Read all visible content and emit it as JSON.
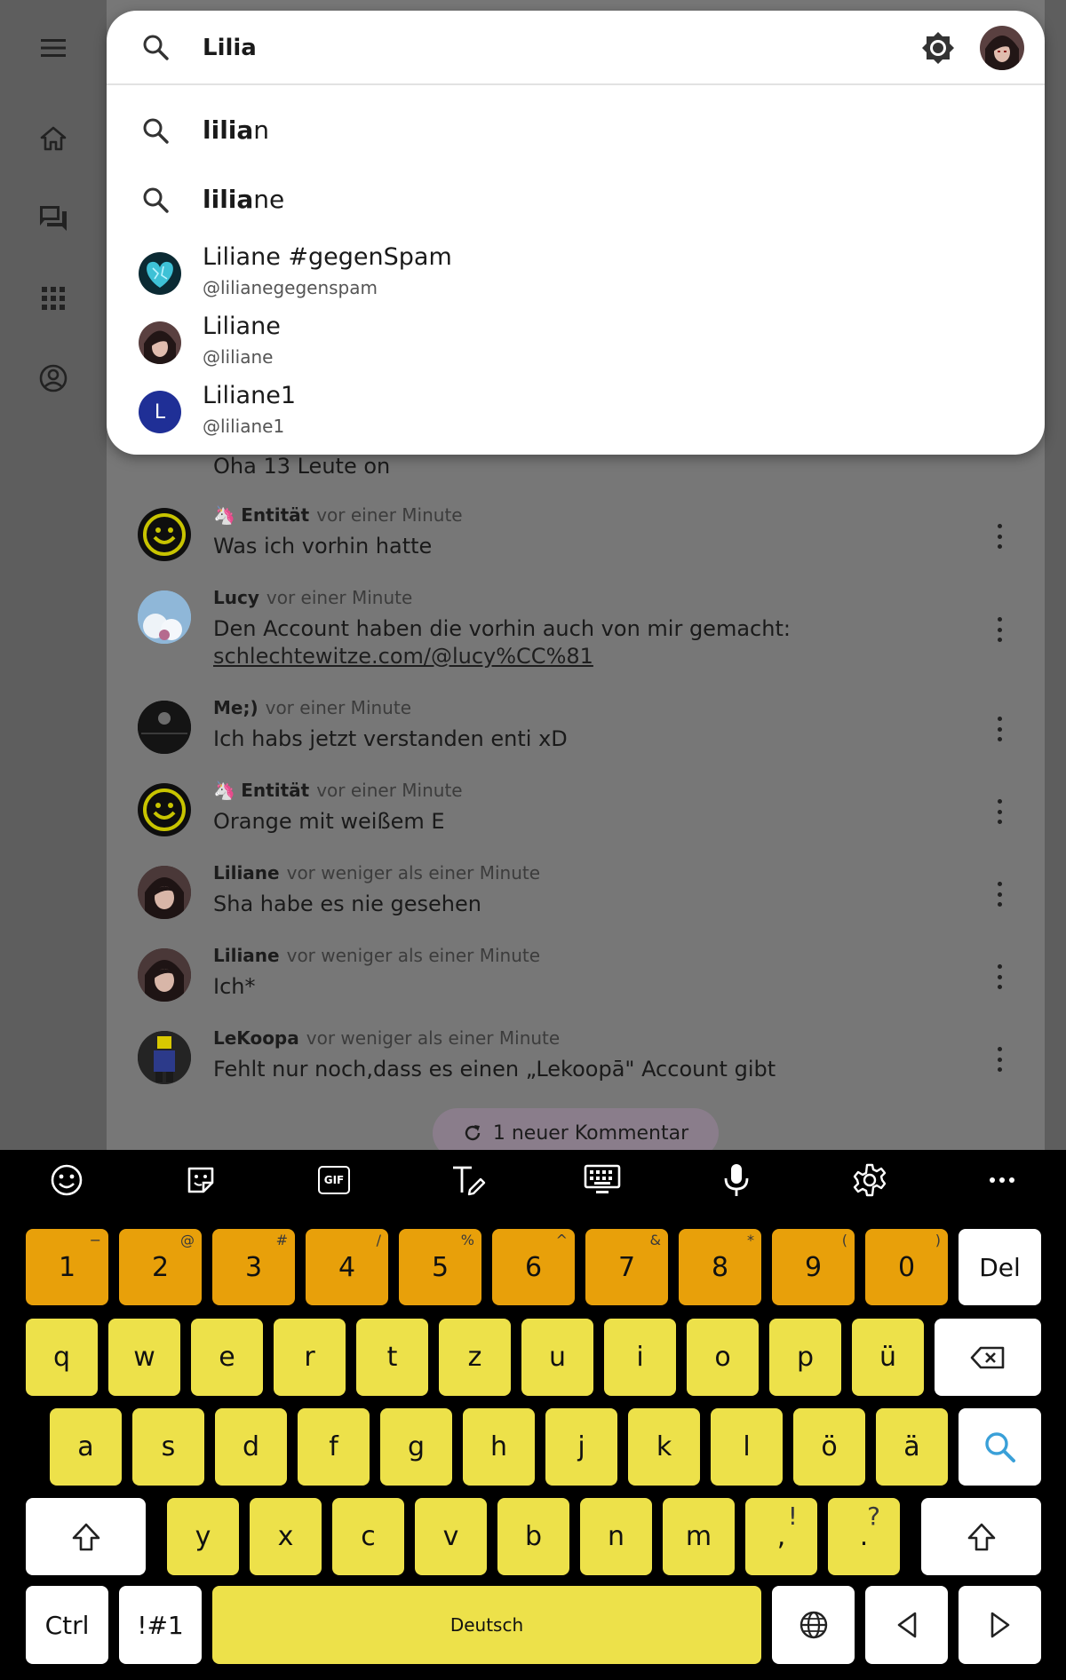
{
  "rail": {
    "items": [
      "menu-icon",
      "home-icon",
      "forum-icon",
      "apps-icon",
      "account-icon"
    ]
  },
  "search": {
    "value": "Lilia",
    "suggestions": [
      {
        "match": "lilia",
        "rest": "n"
      },
      {
        "match": "lilia",
        "rest": "ne"
      }
    ],
    "users": [
      {
        "name": "Liliane #gegenSpam",
        "handle": "@lilianegegenspam"
      },
      {
        "name": "Liliane",
        "handle": "@liliane"
      },
      {
        "name": "Liliane1",
        "handle": "@liliane1",
        "initial": "L"
      }
    ]
  },
  "comments": [
    {
      "author": "",
      "time": "",
      "text": "Oha 13 Leute on"
    },
    {
      "author": "Entität",
      "time": "vor einer Minute",
      "text": "Was ich vorhin hatte"
    },
    {
      "author": "Lucy",
      "time": "vor einer Minute",
      "text": "Den Account haben die vorhin auch von mir gemacht:",
      "link": "schlechtewitze.com/@lucy%CC%81"
    },
    {
      "author": "Me;)",
      "time": "vor einer Minute",
      "text": "Ich habs jetzt verstanden enti xD"
    },
    {
      "author": "Entität",
      "time": "vor einer Minute",
      "text": "Orange mit weißem E"
    },
    {
      "author": "Liliane",
      "time": "vor weniger als einer Minute",
      "text": "Sha habe es nie gesehen"
    },
    {
      "author": "Liliane",
      "time": "vor weniger als einer Minute",
      "text": "Ich*"
    },
    {
      "author": "LeKoopa",
      "time": "vor weniger als einer Minute",
      "text": "Fehlt nur noch,dass es einen „Lekoopā\" Account gibt"
    }
  ],
  "new_comment_label": "1 neuer Kommentar",
  "keyboard": {
    "toolbar": [
      "emoji-icon",
      "sticker-icon",
      "gif-icon",
      "handwriting-icon",
      "keyboard-icon",
      "mic-icon",
      "settings-icon",
      "more-icon"
    ],
    "gif_label": "GIF",
    "numbers": [
      {
        "main": "1",
        "sub": "−"
      },
      {
        "main": "2",
        "sub": "@"
      },
      {
        "main": "3",
        "sub": "#"
      },
      {
        "main": "4",
        "sub": "/"
      },
      {
        "main": "5",
        "sub": "%"
      },
      {
        "main": "6",
        "sub": "^"
      },
      {
        "main": "7",
        "sub": "&"
      },
      {
        "main": "8",
        "sub": "*"
      },
      {
        "main": "9",
        "sub": "("
      },
      {
        "main": "0",
        "sub": ")"
      }
    ],
    "del_label": "Del",
    "row1": [
      "q",
      "w",
      "e",
      "r",
      "t",
      "z",
      "u",
      "i",
      "o",
      "p",
      "ü"
    ],
    "row2": [
      "a",
      "s",
      "d",
      "f",
      "g",
      "h",
      "j",
      "k",
      "l",
      "ö",
      "ä"
    ],
    "row3": [
      "y",
      "x",
      "c",
      "v",
      "b",
      "n",
      "m"
    ],
    "comma": {
      "main": ",",
      "sub": "!"
    },
    "period": {
      "main": ".",
      "sub": "?"
    },
    "ctrl_label": "Ctrl",
    "symbols_label": "!#1",
    "space_label": "Deutsch",
    "colors": {
      "number_keys": "#e8a00a",
      "letter_keys": "#ede14a",
      "function_keys": "#ffffff",
      "search_accent": "#3aa0d8"
    }
  }
}
